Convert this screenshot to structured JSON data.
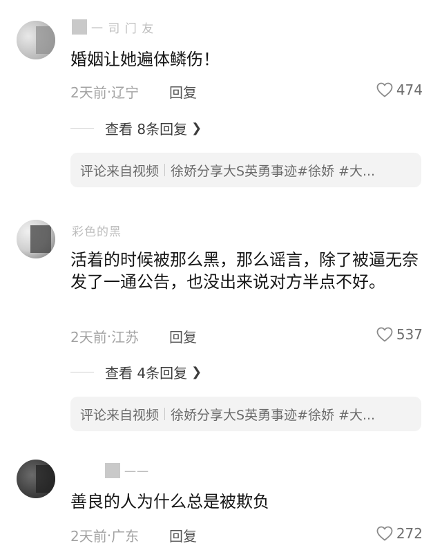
{
  "comments": [
    {
      "username_fragment": "一 司 门 友",
      "text": "婚姻让她遍体鳞伤！",
      "time": "2天前",
      "location": "辽宁",
      "reply_label": "回复",
      "likes": "474",
      "view_replies": "查看 8条回复",
      "source_label": "评论来自视频",
      "source_topic": "徐娇分享大S英勇事迹#徐娇 #大..."
    },
    {
      "username_fragment": "彩色的黑",
      "text": "活着的时候被那么黑，那么谣言，除了被逼无奈发了一通公告，也没出来说对方半点不好。",
      "time": "2天前",
      "location": "江苏",
      "reply_label": "回复",
      "likes": "537",
      "view_replies": "查看 4条回复",
      "source_label": "评论来自视频",
      "source_topic": "徐娇分享大S英勇事迹#徐娇 #大..."
    },
    {
      "username_fragment": "一一",
      "text": "善良的人为什么总是被欺负",
      "time": "2天前",
      "location": "广东",
      "reply_label": "回复",
      "likes": "272"
    }
  ],
  "meta_separator": "·",
  "icons": {
    "like": "heart-outline-icon",
    "chevron": "chevron-right-icon"
  },
  "colors": {
    "text": "#161616",
    "meta": "#a3a3a3",
    "source_bg": "#f3f3f3"
  }
}
